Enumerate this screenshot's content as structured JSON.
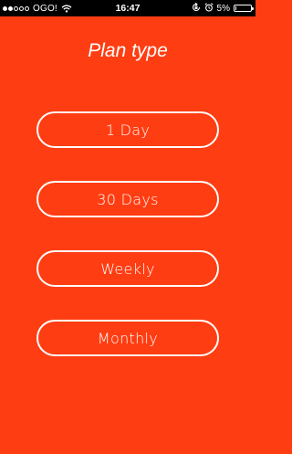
{
  "status_bar": {
    "carrier": "OGO!",
    "time": "16:47",
    "battery_percent": "5%",
    "battery_level": 0.05,
    "signal_bars_filled": 2,
    "signal_bars_total": 5,
    "icons": [
      "signal-dots-icon",
      "wifi-icon",
      "rotation-lock-icon",
      "alarm-icon",
      "battery-icon"
    ]
  },
  "screen": {
    "title": "Plan type"
  },
  "plans": [
    {
      "label": "1 Day"
    },
    {
      "label": "30 Days"
    },
    {
      "label": "Weekly"
    },
    {
      "label": "Monthly"
    }
  ],
  "colors": {
    "background": "#ff3d12",
    "foreground": "#ffffff",
    "status_bar": "#000000"
  }
}
